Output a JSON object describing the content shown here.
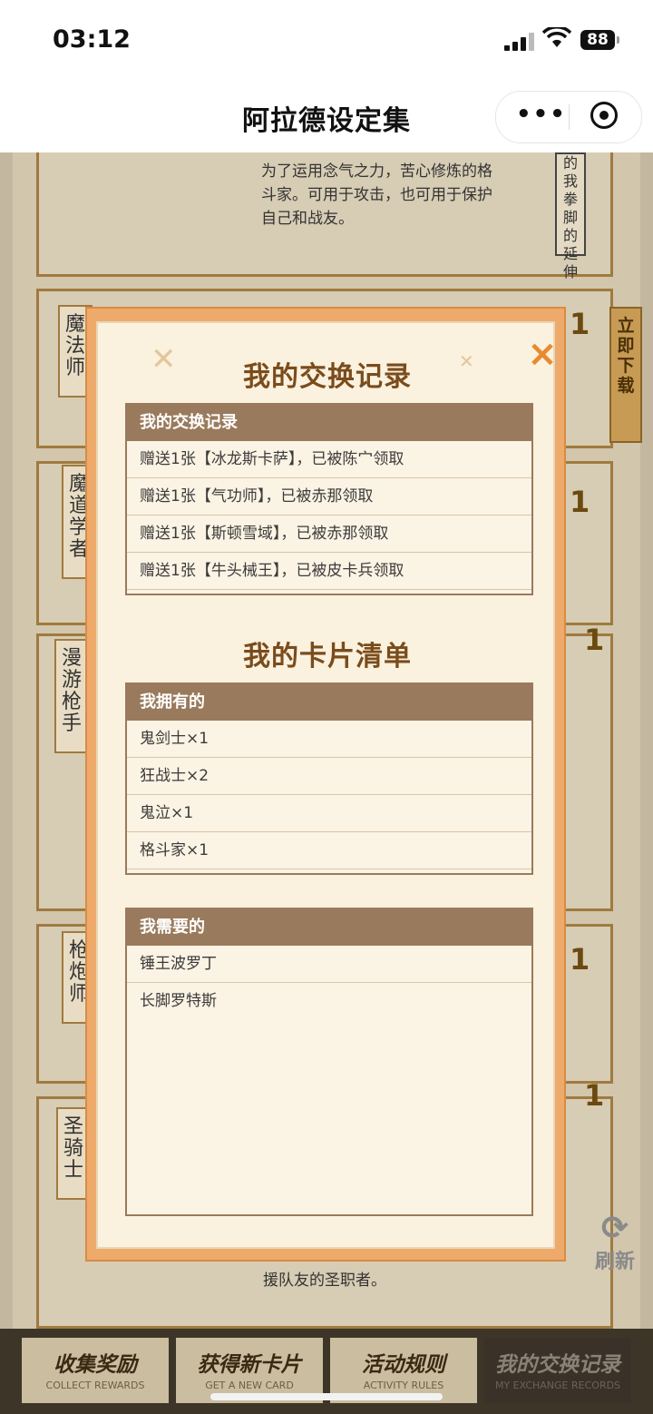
{
  "status_bar": {
    "time": "03:12",
    "battery": "88"
  },
  "nav": {
    "title": "阿拉德设定集",
    "more_label": "•••"
  },
  "background": {
    "desc_top": "为了运用念气之力，苦心修炼的格斗家。可用于攻击，也可用于保护自己和战友。",
    "side_text_top": "的我拳脚的延伸",
    "download_label": "立即下载",
    "cards": [
      {
        "tag": "魔法师",
        "count": "1"
      },
      {
        "tag": "魔道学者",
        "count": "1"
      },
      {
        "tag": "漫游枪手",
        "count": "1"
      },
      {
        "tag": "枪炮师",
        "count": "1"
      },
      {
        "tag": "圣骑士",
        "count": "1"
      }
    ],
    "refresh_label": "刷新",
    "desc_bottom": "援队友的圣职者。"
  },
  "bottom_tabs": [
    {
      "title": "收集奖励",
      "subtitle": "COLLECT REWARDS"
    },
    {
      "title": "获得新卡片",
      "subtitle": "GET A NEW CARD"
    },
    {
      "title": "活动规则",
      "subtitle": "ACTIVITY RULES"
    },
    {
      "title": "我的交换记录",
      "subtitle": "MY EXCHANGE RECORDS"
    }
  ],
  "modal": {
    "close_icon": "×",
    "section1_title": "我的交换记录",
    "records_table": {
      "header": "我的交换记录",
      "rows": [
        "赠送1张【冰龙斯卡萨】，已被陈宀领取",
        "赠送1张【气功师】，已被赤那领取",
        "赠送1张【斯顿雪域】，已被赤那领取",
        "赠送1张【牛头械王】，已被皮卡兵领取"
      ]
    },
    "section2_title": "我的卡片清单",
    "owned_table": {
      "header": "我拥有的",
      "rows": [
        "鬼剑士×1",
        "狂战士×2",
        "鬼泣×1",
        "格斗家×1"
      ]
    },
    "needed_table": {
      "header": "我需要的",
      "rows": [
        "锤王波罗丁",
        "长脚罗特斯"
      ]
    }
  }
}
